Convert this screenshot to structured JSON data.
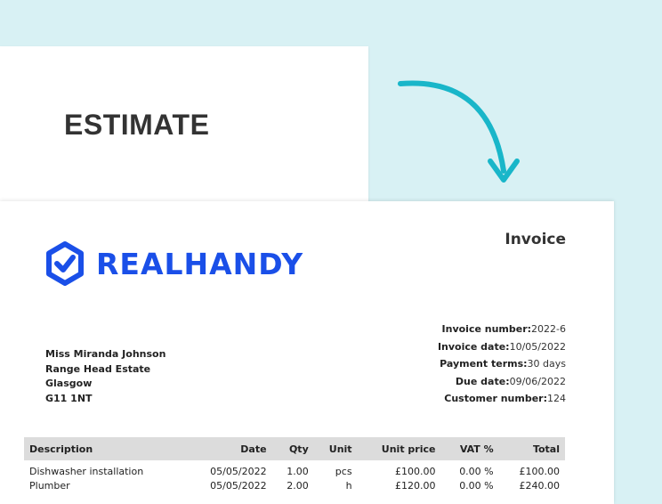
{
  "estimate": {
    "title": "ESTIMATE"
  },
  "invoice": {
    "title": "Invoice",
    "brand": "REALHANDY",
    "meta": [
      {
        "label": "Invoice number:",
        "value": "2022-6"
      },
      {
        "label": "Invoice date:",
        "value": "10/05/2022"
      },
      {
        "label": "Payment terms:",
        "value": "30 days"
      },
      {
        "label": "Due date:",
        "value": "09/06/2022"
      },
      {
        "label": "Customer number:",
        "value": "124"
      }
    ],
    "address": [
      "Miss Miranda Johnson",
      "Range Head Estate",
      "Glasgow",
      "G11 1NT"
    ],
    "columns": [
      "Description",
      "Date",
      "Qty",
      "Unit",
      "Unit price",
      "VAT %",
      "Total"
    ],
    "rows": [
      [
        "Dishwasher installation",
        "05/05/2022",
        "1.00",
        "pcs",
        "£100.00",
        "0.00 %",
        "£100.00"
      ],
      [
        "Plumber",
        "05/05/2022",
        "2.00",
        "h",
        "£120.00",
        "0.00 %",
        "£240.00"
      ]
    ]
  },
  "colors": {
    "background": "#d8f1f4",
    "brand": "#1a4fe8",
    "arrow": "#19b6c9",
    "table_header": "#dcdcdc"
  }
}
